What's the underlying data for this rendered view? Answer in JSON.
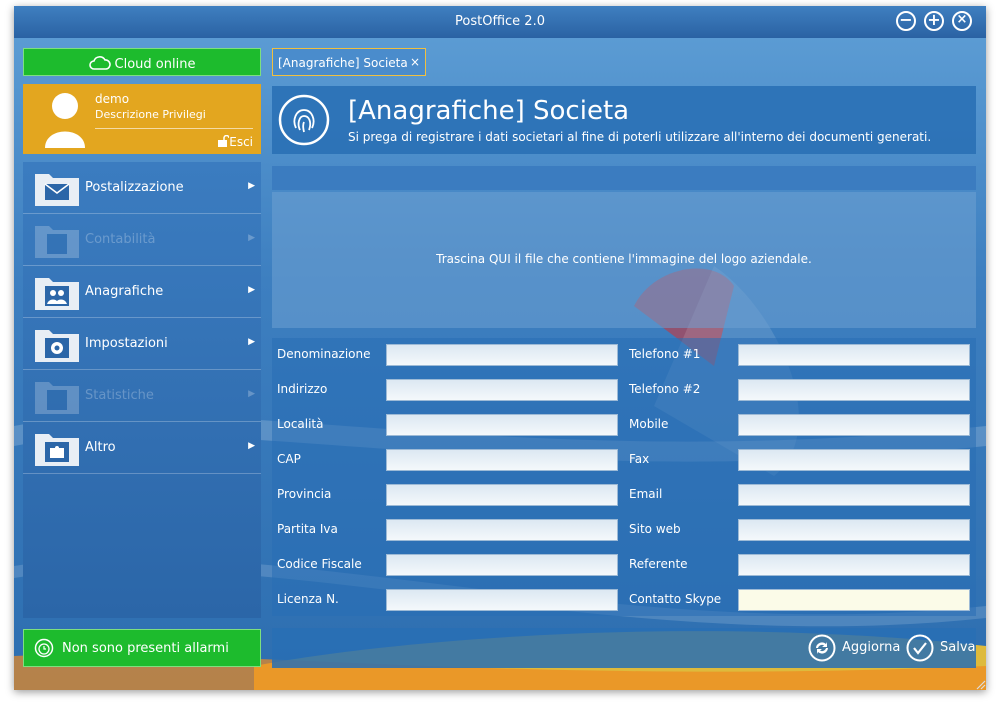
{
  "window": {
    "title": "PostOffice 2.0"
  },
  "sidebar": {
    "cloud_label": "Cloud online",
    "user": {
      "name": "demo",
      "privileges": "Descrizione Privilegi",
      "logout": "Esci"
    },
    "menu": [
      {
        "label": "Postalizzazione",
        "icon": "mail-icon",
        "enabled": true
      },
      {
        "label": "Contabilità",
        "icon": "calculator-icon",
        "enabled": false
      },
      {
        "label": "Anagrafiche",
        "icon": "people-icon",
        "enabled": true
      },
      {
        "label": "Impostazioni",
        "icon": "gear-icon",
        "enabled": true
      },
      {
        "label": "Statistiche",
        "icon": "bar-chart-icon",
        "enabled": false
      },
      {
        "label": "Altro",
        "icon": "puzzle-icon",
        "enabled": true
      }
    ],
    "alarm_label": "Non sono presenti allarmi"
  },
  "tabs": [
    {
      "label": "[Anagrafiche] Societa",
      "close": "×"
    }
  ],
  "header": {
    "title": "[Anagrafiche] Societa",
    "subtitle": "Si prega di registrare i dati societari al fine di poterli utilizzare all'interno dei documenti generati."
  },
  "logo_drop": {
    "text": "Trascina QUI il file che contiene l'immagine del logo aziendale."
  },
  "form": {
    "left": [
      {
        "label": "Denominazione",
        "value": ""
      },
      {
        "label": "Indirizzo",
        "value": ""
      },
      {
        "label": "Località",
        "value": ""
      },
      {
        "label": "CAP",
        "value": ""
      },
      {
        "label": "Provincia",
        "value": ""
      },
      {
        "label": "Partita Iva",
        "value": ""
      },
      {
        "label": "Codice Fiscale",
        "value": ""
      },
      {
        "label": "Licenza N.",
        "value": ""
      }
    ],
    "right": [
      {
        "label": "Telefono #1",
        "value": ""
      },
      {
        "label": "Telefono #2",
        "value": ""
      },
      {
        "label": "Mobile",
        "value": ""
      },
      {
        "label": "Fax",
        "value": ""
      },
      {
        "label": "Email",
        "value": ""
      },
      {
        "label": "Sito web",
        "value": ""
      },
      {
        "label": "Referente",
        "value": ""
      },
      {
        "label": "Contatto Skype",
        "value": ""
      }
    ]
  },
  "footer": {
    "refresh_label": "Aggiorna",
    "save_label": "Salva"
  },
  "colors": {
    "accent_green": "#1dbb2d",
    "accent_orange": "#e3a61f",
    "panel_blue": "#3b7cc0"
  }
}
